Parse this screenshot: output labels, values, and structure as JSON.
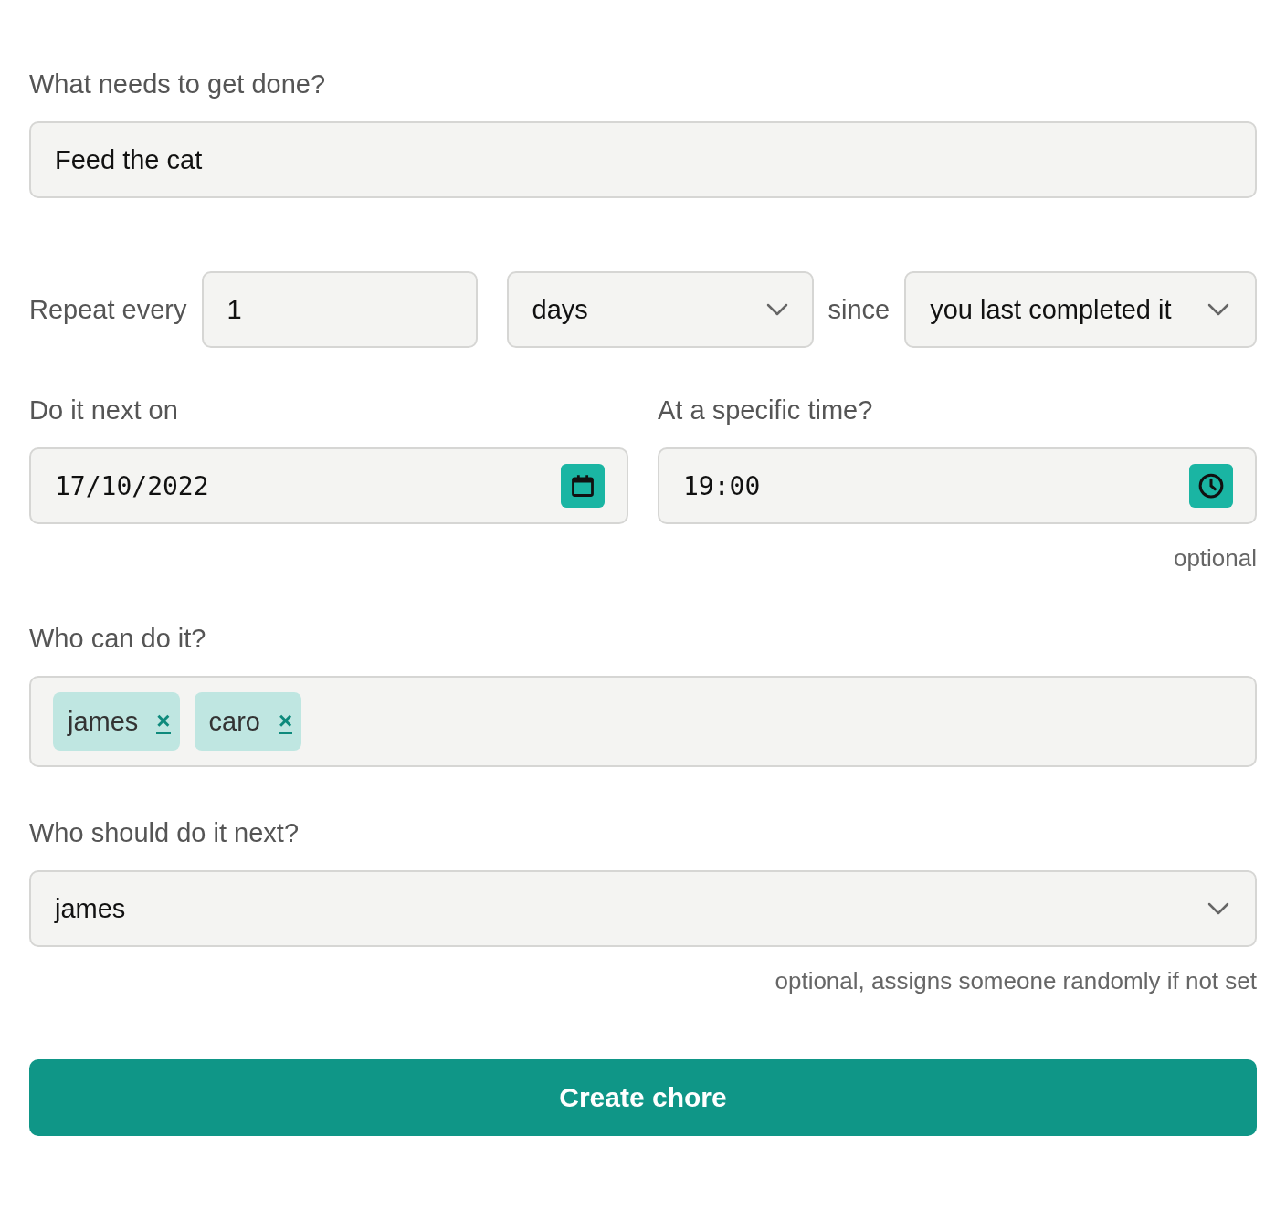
{
  "title_field": {
    "label": "What needs to get done?",
    "value": "Feed the cat"
  },
  "repeat": {
    "label": "Repeat every",
    "count": "1",
    "unit": "days",
    "since_label": "since",
    "since": "you last completed it"
  },
  "next_date": {
    "label": "Do it next on",
    "value": "17/10/2022"
  },
  "time": {
    "label": "At a specific time?",
    "value": "19:00",
    "hint": "optional"
  },
  "assignees": {
    "label": "Who can do it?",
    "tags": [
      {
        "name": "james",
        "remove": "×"
      },
      {
        "name": "caro",
        "remove": "×"
      }
    ]
  },
  "next_person": {
    "label": "Who should do it next?",
    "value": "james",
    "hint": "optional, assigns someone randomly if not set"
  },
  "submit": {
    "label": "Create chore"
  }
}
